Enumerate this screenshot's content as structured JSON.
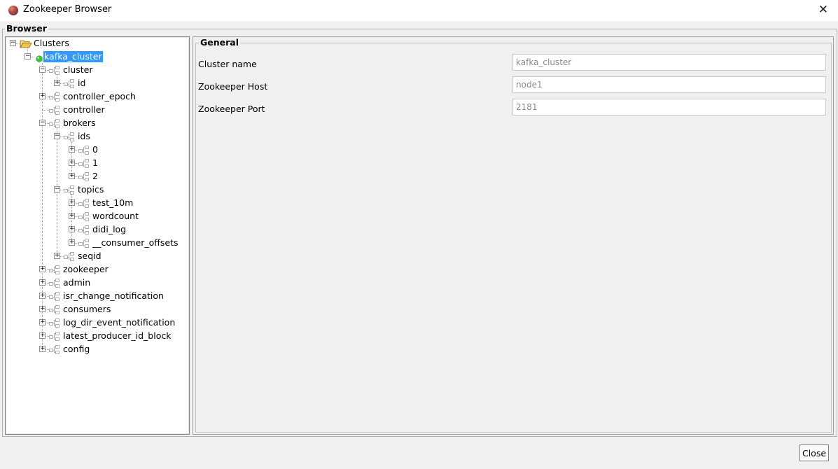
{
  "window": {
    "title": "Zookeeper Browser"
  },
  "browser_group": {
    "legend": "Browser"
  },
  "tree": {
    "nodes": [
      {
        "label": "Clusters",
        "depth": 0,
        "expander": "minus",
        "icon": "folder-open-icon"
      },
      {
        "label": "kafka_cluster",
        "depth": 1,
        "expander": "minus",
        "icon": "connected-status-icon",
        "selected": true
      },
      {
        "label": "cluster",
        "depth": 2,
        "expander": "minus",
        "icon": "znode-icon"
      },
      {
        "label": "id",
        "depth": 3,
        "expander": "plus",
        "icon": "znode-icon"
      },
      {
        "label": "controller_epoch",
        "depth": 2,
        "expander": "plus",
        "icon": "znode-icon"
      },
      {
        "label": "controller",
        "depth": 2,
        "expander": "none",
        "icon": "znode-icon"
      },
      {
        "label": "brokers",
        "depth": 2,
        "expander": "minus",
        "icon": "znode-icon"
      },
      {
        "label": "ids",
        "depth": 3,
        "expander": "minus",
        "icon": "znode-icon"
      },
      {
        "label": "0",
        "depth": 4,
        "expander": "plus",
        "icon": "znode-icon"
      },
      {
        "label": "1",
        "depth": 4,
        "expander": "plus",
        "icon": "znode-icon"
      },
      {
        "label": "2",
        "depth": 4,
        "expander": "plus",
        "icon": "znode-icon"
      },
      {
        "label": "topics",
        "depth": 3,
        "expander": "minus",
        "icon": "znode-icon"
      },
      {
        "label": "test_10m",
        "depth": 4,
        "expander": "plus",
        "icon": "znode-icon"
      },
      {
        "label": "wordcount",
        "depth": 4,
        "expander": "plus",
        "icon": "znode-icon"
      },
      {
        "label": "didi_log",
        "depth": 4,
        "expander": "plus",
        "icon": "znode-icon"
      },
      {
        "label": "__consumer_offsets",
        "depth": 4,
        "expander": "plus",
        "icon": "znode-icon"
      },
      {
        "label": "seqid",
        "depth": 3,
        "expander": "plus",
        "icon": "znode-icon"
      },
      {
        "label": "zookeeper",
        "depth": 2,
        "expander": "plus",
        "icon": "znode-icon"
      },
      {
        "label": "admin",
        "depth": 2,
        "expander": "plus",
        "icon": "znode-icon"
      },
      {
        "label": "isr_change_notification",
        "depth": 2,
        "expander": "plus",
        "icon": "znode-icon"
      },
      {
        "label": "consumers",
        "depth": 2,
        "expander": "plus",
        "icon": "znode-icon"
      },
      {
        "label": "log_dir_event_notification",
        "depth": 2,
        "expander": "plus",
        "icon": "znode-icon"
      },
      {
        "label": "latest_producer_id_block",
        "depth": 2,
        "expander": "plus",
        "icon": "znode-icon"
      },
      {
        "label": "config",
        "depth": 2,
        "expander": "plus",
        "icon": "znode-icon"
      }
    ]
  },
  "general": {
    "legend": "General",
    "cluster_name_label": "Cluster name",
    "cluster_name_value": "kafka_cluster",
    "zk_host_label": "Zookeeper Host",
    "zk_host_value": "node1",
    "zk_port_label": "Zookeeper Port",
    "zk_port_value": "2181"
  },
  "buttons": {
    "close_label": "Close"
  },
  "colors": {
    "selection": "#3399ff",
    "connected_status": "#37c837",
    "folder": "#f3c44c"
  }
}
